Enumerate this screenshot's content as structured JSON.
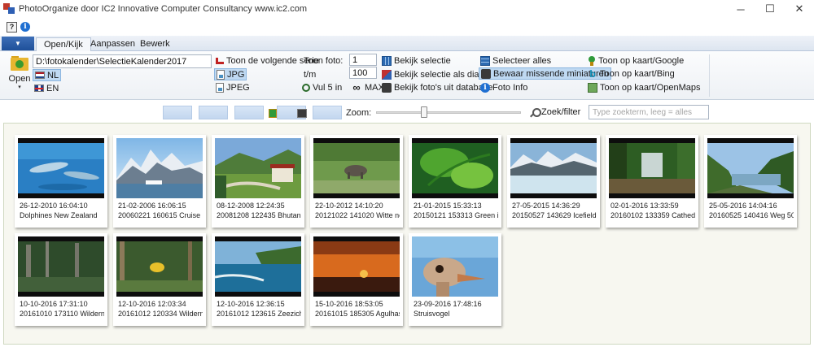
{
  "window": {
    "title": "PhotoOrganize door IC2 Innovative Computer Consultancy www.ic2.com",
    "minimize": "─",
    "maximize": "☐",
    "close": "✕"
  },
  "qat": {
    "help_label": "?",
    "info_label": "i"
  },
  "tabs": [
    {
      "label": "Open/Kijk",
      "active": true
    },
    {
      "label": "Aanpassen",
      "active": false
    },
    {
      "label": "Bewerk",
      "active": false
    }
  ],
  "ribbon": {
    "open_label": "Open",
    "open_caret": "▾",
    "path_value": "D:\\fotokalender\\SelectieKalender2017",
    "lang_nl": "NL",
    "lang_en": "EN",
    "toon_volgende_serie": "Toon de volgende serie",
    "jpg": "JPG",
    "jpeg": "JPEG",
    "toon_foto_label": "Toon foto:",
    "toon_foto_from": "1",
    "tm_label": "t/m",
    "toon_foto_to": "100",
    "vul_5_in": "Vul 5 in",
    "max_label": "MAX",
    "bekijk_selectie": "Bekijk selectie",
    "bekijk_diashow": "Bekijk selectie als diashow",
    "bekijk_database": "Bekijk foto's uit database",
    "selecteer_alles": "Selecteer alles",
    "bewaar_miniaturen": "Bewaar missende miniaturen",
    "foto_info": "Foto Info",
    "kaart_google": "Toon op kaart/Google",
    "kaart_bing": "Toon op kaart/Bing",
    "kaart_osm": "Toon op kaart/OpenMaps",
    "bing_glyph": "b"
  },
  "toolbar": {
    "zoom_label": "Zoom:",
    "zoom_value": 0.33,
    "zoek_label": "Zoek/filter",
    "search_placeholder": "Type zoekterm, leeg = alles"
  },
  "photos": [
    {
      "date": "26-12-2010 16:04:10",
      "name": "Dolphines New Zealand"
    },
    {
      "date": "21-02-2006 16:06:15",
      "name": "20060221 160615 Cruise - A"
    },
    {
      "date": "08-12-2008 12:24:35",
      "name": "20081208 122435 Bhutan P"
    },
    {
      "date": "22-10-2012 14:10:20",
      "name": "20121022 141020 Witte neu"
    },
    {
      "date": "21-01-2015 15:33:13",
      "name": "20150121 153313 Green igu"
    },
    {
      "date": "27-05-2015 14:36:29",
      "name": "20150527 143629 Icefield P"
    },
    {
      "date": "02-01-2016 13:33:59",
      "name": "20160102 133359 Cathedra"
    },
    {
      "date": "25-05-2016 14:04:16",
      "name": "20160525 140416 Weg 50 n"
    },
    {
      "date": "10-10-2016 17:31:10",
      "name": "20161010 173110 Wilderne"
    },
    {
      "date": "12-10-2016 12:03:34",
      "name": "20161012 120334 Wilderne"
    },
    {
      "date": "12-10-2016 12:36:15",
      "name": "20161012 123615 Zeezicht"
    },
    {
      "date": "15-10-2016 18:53:05",
      "name": "20161015 185305 Agulhas L"
    },
    {
      "date": "23-09-2016 17:48:16",
      "name": "Struisvogel"
    }
  ]
}
